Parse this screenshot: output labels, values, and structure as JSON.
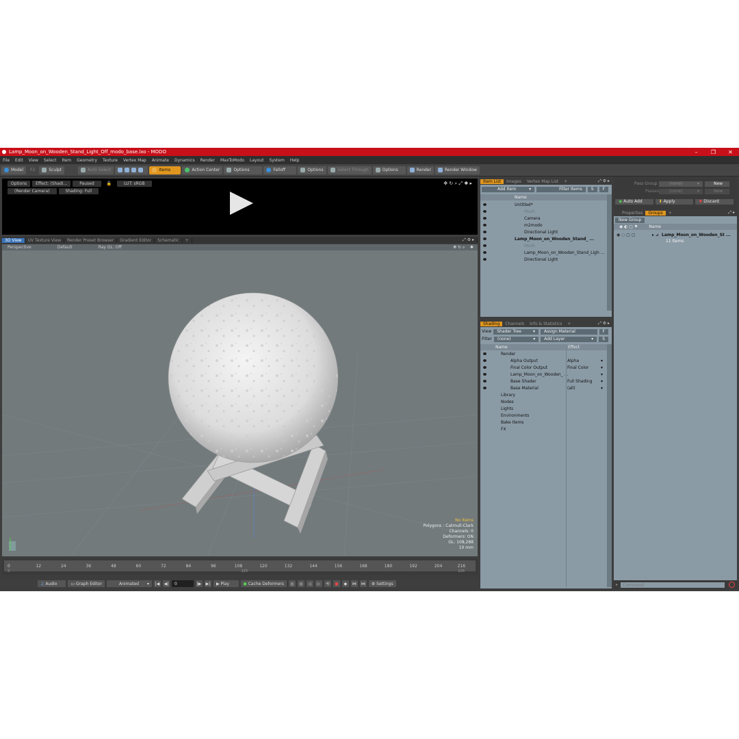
{
  "window": {
    "title": "Lamp_Moon_on_Wooden_Stand_Light_Off_modo_base.lxo - MODO",
    "controls": [
      "–",
      "❐",
      "✕"
    ]
  },
  "menu": [
    "File",
    "Edit",
    "View",
    "Select",
    "Item",
    "Geometry",
    "Texture",
    "Vertex Map",
    "Animate",
    "Dynamics",
    "Render",
    "MaxToModo",
    "Layout",
    "System",
    "Help"
  ],
  "toolbar": {
    "model": "Model",
    "f2": "F2",
    "sculpt": "Sculpt",
    "auto_select": "Auto Select",
    "items": "Items",
    "action_center": "Action Center",
    "options1": "Options",
    "falloff": "Falloff",
    "options2": "Options",
    "select_through": "Select Through",
    "options3": "Options",
    "render": "Render",
    "render_window": "Render Window"
  },
  "preview": {
    "options": "Options",
    "effect": "Effect: (Shadi...",
    "paused": "Paused",
    "lut": "LUT: sRGB",
    "camera": "(Render Camera)",
    "shading": "Shading: Full"
  },
  "viewport_tabs": [
    "3D View",
    "UV Texture View",
    "Render Preset Browser",
    "Gradient Editor",
    "Schematic",
    "+"
  ],
  "viewport": {
    "perspective": "Perspective",
    "default": "Default",
    "raygl": "Ray GL: Off"
  },
  "stats": {
    "no_items": "No Items",
    "polygons": "Polygons : Catmull-Clark",
    "channels": "Channels: 0",
    "deformers": "Deformers: ON",
    "gl": "GL: 108,288",
    "scale": "10 mm"
  },
  "timeline": {
    "labels": [
      "0",
      "12",
      "24",
      "36",
      "48",
      "60",
      "72",
      "84",
      "96",
      "108",
      "120",
      "132",
      "144",
      "156",
      "168",
      "180",
      "192",
      "204",
      "216"
    ],
    "sub": [
      "0",
      "",
      "225",
      "",
      "225"
    ]
  },
  "bottombar": {
    "audio": "Audio",
    "graph_editor": "Graph Editor",
    "animated": "Animated",
    "frame": "0",
    "play": "Play",
    "cache_deformers": "Cache Deformers",
    "settings": "Settings"
  },
  "item_list": {
    "tabs": [
      "Item List",
      "Images",
      "Vertex Map List",
      "+"
    ],
    "add_item": "Add Item",
    "filter_items": "Filter Items",
    "s": "S",
    "f": "F",
    "col_name": "Name",
    "rows": [
      {
        "label": "Untitled*",
        "indent": 50,
        "bold": false,
        "dim": false
      },
      {
        "label": "Mesh",
        "indent": 64,
        "bold": false,
        "dim": true
      },
      {
        "label": "Camera",
        "indent": 64,
        "bold": false,
        "dim": false
      },
      {
        "label": "m2modo",
        "indent": 64,
        "bold": false,
        "dim": false
      },
      {
        "label": "Directional Light",
        "indent": 64,
        "bold": false,
        "dim": false
      },
      {
        "label": "Lamp_Moon_on_Wooden_Stand_ ...",
        "indent": 50,
        "bold": true,
        "dim": false
      },
      {
        "label": "Mesh",
        "indent": 64,
        "bold": false,
        "dim": true
      },
      {
        "label": "Lamp_Moon_on_Wooden_Stand_Ligh ...",
        "indent": 64,
        "bold": false,
        "dim": false
      },
      {
        "label": "Directional Light",
        "indent": 64,
        "bold": false,
        "dim": false
      }
    ]
  },
  "shading": {
    "tabs": [
      "Shading",
      "Channels",
      "Info & Statistics",
      "+"
    ],
    "view_label": "View",
    "view_value": "Shader Tree",
    "assign_material": "Assign Material",
    "f": "F",
    "filter_label": "Filter",
    "filter_value": "(none)",
    "add_layer": "Add Layer",
    "s": "S",
    "col_name": "Name",
    "col_effect": "Effect",
    "rows": [
      {
        "label": "Render",
        "effect": "",
        "indent": 30
      },
      {
        "label": "Alpha Output",
        "effect": "Alpha",
        "indent": 44
      },
      {
        "label": "Final Color Output",
        "effect": "Final Color",
        "indent": 44
      },
      {
        "label": "Lamp_Moon_on_Wooden_ ...",
        "effect": "",
        "indent": 44
      },
      {
        "label": "Base Shader",
        "effect": "Full Shading",
        "indent": 44
      },
      {
        "label": "Base Material",
        "effect": "(all)",
        "indent": 44
      },
      {
        "label": "Library",
        "effect": "",
        "indent": 30
      },
      {
        "label": "Nodes",
        "effect": "",
        "indent": 30
      },
      {
        "label": "Lights",
        "effect": "",
        "indent": 30
      },
      {
        "label": "Environments",
        "effect": "",
        "indent": 30
      },
      {
        "label": "Bake Items",
        "effect": "",
        "indent": 30
      },
      {
        "label": "FX",
        "effect": "",
        "indent": 30
      }
    ]
  },
  "groups": {
    "pass_group": "Pass Group",
    "pass_value": "(none)",
    "new": "New",
    "passes": "Passes",
    "passes_value": "(none)",
    "new2": "New",
    "auto_add": "Auto Add",
    "apply": "Apply",
    "discard": "Discard",
    "tabs": [
      "Properties",
      "Groups",
      "+"
    ],
    "new_group": "New Group",
    "col_name": "Name",
    "group_name": "Lamp_Moon_on_Wooden_St ...",
    "group_items": "11 Items"
  },
  "command": {
    "placeholder": "Command"
  }
}
